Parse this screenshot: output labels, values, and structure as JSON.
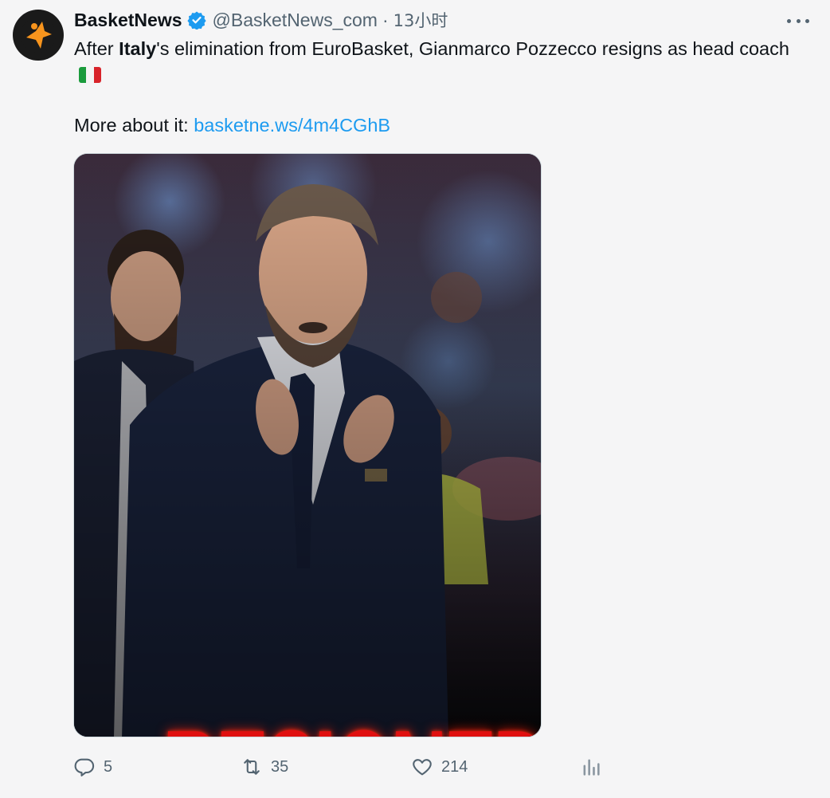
{
  "author": {
    "name": "BasketNews",
    "handle": "@BasketNews_com",
    "separator": "·",
    "time": "13小时",
    "avatar_icon": "basketnews-logo-icon",
    "verified_icon": "verified-badge-icon"
  },
  "tweet": {
    "text_before": "After ",
    "text_bold": "Italy",
    "text_after": "'s elimination from EuroBasket, Gianmarco Pozzecco resigns as head coach",
    "flag_icon": "italy-flag-icon",
    "more_label": "More about it: ",
    "link": "basketne.ws/4m4CGhB"
  },
  "media": {
    "overlay_text": "RESIGNED",
    "overlay_color": "#e01010"
  },
  "actions": {
    "replies": "5",
    "retweets": "35",
    "likes": "214",
    "reply_icon": "reply-icon",
    "retweet_icon": "retweet-icon",
    "like_icon": "heart-icon",
    "views_icon": "analytics-icon"
  },
  "colors": {
    "link": "#1d9bf0",
    "muted": "#536471",
    "verified": "#1d9bf0"
  }
}
